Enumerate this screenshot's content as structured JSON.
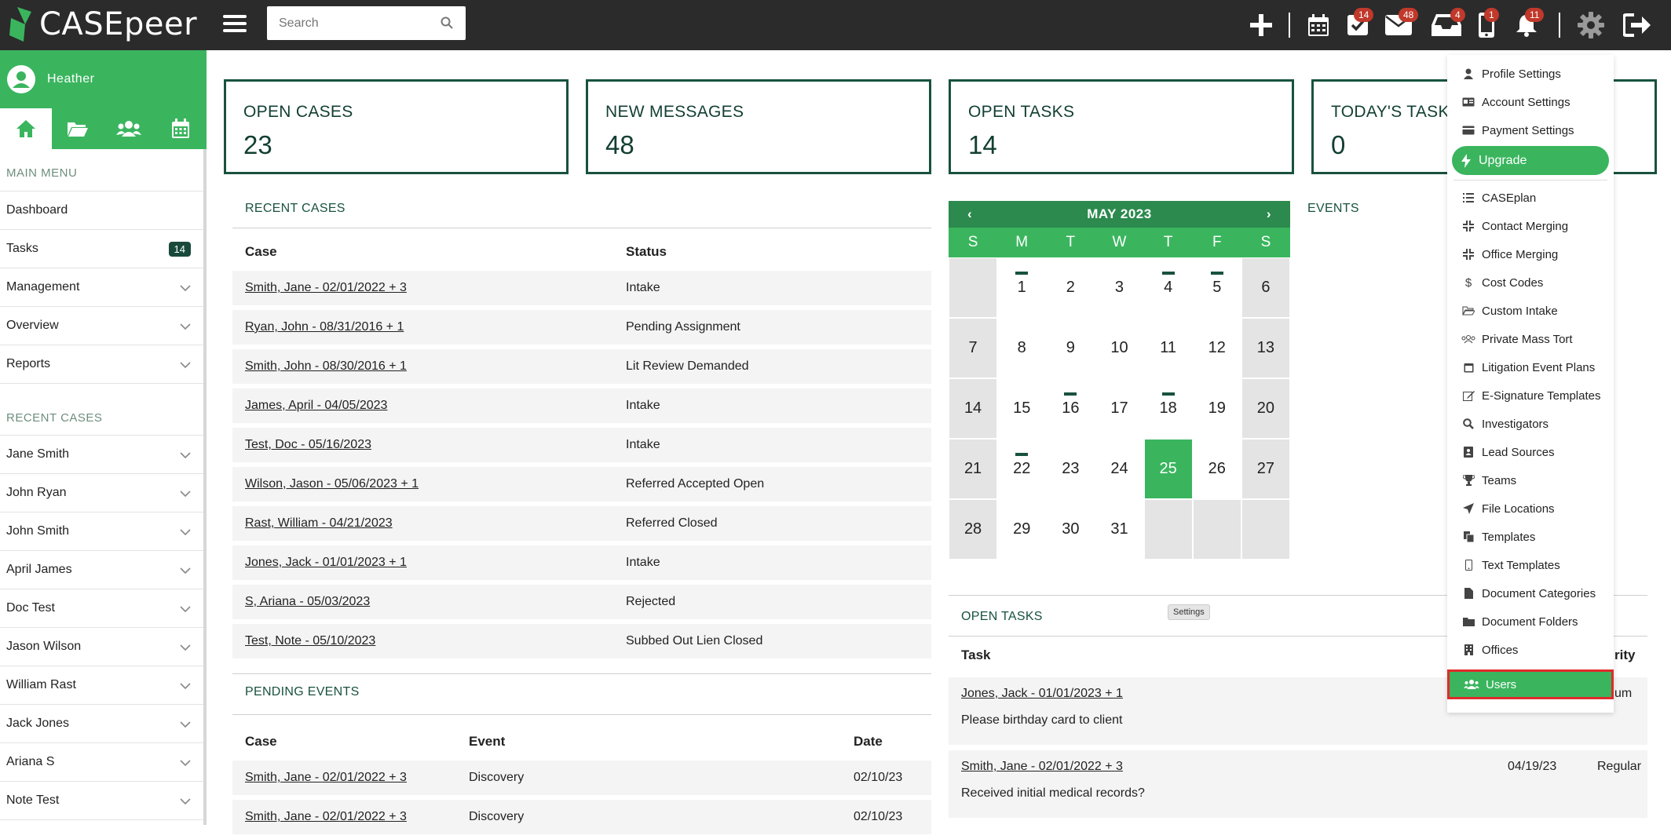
{
  "app": {
    "name": "CASEpeer"
  },
  "search": {
    "placeholder": "Search"
  },
  "topbar": {
    "badges": {
      "tasks": "14",
      "messages": "48",
      "inbox": "4",
      "phone": "1",
      "notifications": "11"
    }
  },
  "sidebar": {
    "user_name": "Heather",
    "main_menu_title": "MAIN MENU",
    "main_menu": [
      {
        "label": "Dashboard"
      },
      {
        "label": "Tasks",
        "count": "14"
      },
      {
        "label": "Management"
      },
      {
        "label": "Overview"
      },
      {
        "label": "Reports"
      }
    ],
    "recent_cases_title": "RECENT CASES",
    "recent_cases": [
      "Jane Smith",
      "John Ryan",
      "John Smith",
      "April James",
      "Doc Test",
      "Jason Wilson",
      "William Rast",
      "Jack Jones",
      "Ariana S",
      "Note Test"
    ]
  },
  "cards": [
    {
      "label": "OPEN CASES",
      "value": "23"
    },
    {
      "label": "NEW MESSAGES",
      "value": "48"
    },
    {
      "label": "OPEN TASKS",
      "value": "14"
    },
    {
      "label": "TODAY'S TASK",
      "value": "0"
    }
  ],
  "recent_cases": {
    "title": "RECENT CASES",
    "columns": [
      "Case",
      "Status"
    ],
    "rows": [
      [
        "Smith, Jane - 02/01/2022 + 3",
        "Intake"
      ],
      [
        "Ryan, John - 08/31/2016 + 1",
        "Pending Assignment"
      ],
      [
        "Smith, John - 08/30/2016 + 1",
        "Lit Review Demanded"
      ],
      [
        "James, April - 04/05/2023",
        "Intake"
      ],
      [
        "Test, Doc - 05/16/2023",
        "Intake"
      ],
      [
        "Wilson, Jason - 05/06/2023 + 1",
        "Referred Accepted Open"
      ],
      [
        "Rast, William - 04/21/2023",
        "Referred Closed"
      ],
      [
        "Jones, Jack - 01/01/2023 + 1",
        "Intake"
      ],
      [
        "S, Ariana - 05/03/2023",
        "Rejected"
      ],
      [
        "Test, Note - 05/10/2023",
        "Subbed Out Lien Closed"
      ]
    ]
  },
  "pending_events": {
    "title": "PENDING EVENTS",
    "columns": [
      "Case",
      "Event",
      "Date"
    ],
    "rows": [
      [
        "Smith, Jane - 02/01/2022 + 3",
        "Discovery",
        "02/10/23"
      ],
      [
        "Smith, Jane - 02/01/2022 + 3",
        "Discovery",
        "02/10/23"
      ]
    ]
  },
  "calendar": {
    "month_label": "MAY 2023",
    "prev": "‹",
    "next": "›",
    "dow": [
      "S",
      "M",
      "T",
      "W",
      "T",
      "F",
      "S"
    ],
    "today": 25,
    "event_days": [
      1,
      4,
      5,
      16,
      18,
      22
    ]
  },
  "events": {
    "title": "EVENTS"
  },
  "open_tasks": {
    "title": "OPEN TASKS",
    "columns": [
      "Task",
      "rity"
    ],
    "rows": [
      {
        "case": "Jones, Jack - 01/01/2023 + 1",
        "desc": "Please birthday card to client",
        "date": "",
        "priority": "um"
      },
      {
        "case": "Smith, Jane - 02/01/2022 + 3",
        "desc": "Received initial medical records?",
        "date": "04/19/23",
        "priority": "Regular"
      }
    ]
  },
  "tooltip": "Settings",
  "settings_menu": {
    "items_top": [
      {
        "label": "Profile Settings",
        "icon": "user-icon"
      },
      {
        "label": "Account Settings",
        "icon": "id-card-icon"
      },
      {
        "label": "Payment Settings",
        "icon": "credit-card-icon"
      }
    ],
    "upgrade": "Upgrade",
    "items": [
      {
        "label": "CASEplan",
        "icon": "list-icon"
      },
      {
        "label": "Contact Merging",
        "icon": "compress-icon"
      },
      {
        "label": "Office Merging",
        "icon": "compress-icon"
      },
      {
        "label": "Cost Codes",
        "icon": "dollar-icon"
      },
      {
        "label": "Custom Intake",
        "icon": "folder-open-icon"
      },
      {
        "label": "Private Mass Tort",
        "icon": "users-icon"
      },
      {
        "label": "Litigation Event Plans",
        "icon": "calendar-icon"
      },
      {
        "label": "E-Signature Templates",
        "icon": "edit-icon"
      },
      {
        "label": "Investigators",
        "icon": "search-icon"
      },
      {
        "label": "Lead Sources",
        "icon": "contact-book-icon"
      },
      {
        "label": "Teams",
        "icon": "trophy-icon"
      },
      {
        "label": "File Locations",
        "icon": "location-arrow-icon"
      },
      {
        "label": "Templates",
        "icon": "copy-icon"
      },
      {
        "label": "Text Templates",
        "icon": "mobile-icon"
      },
      {
        "label": "Document Categories",
        "icon": "file-icon"
      },
      {
        "label": "Document Folders",
        "icon": "folder-icon"
      },
      {
        "label": "Offices",
        "icon": "building-icon"
      }
    ],
    "users": "Users"
  }
}
